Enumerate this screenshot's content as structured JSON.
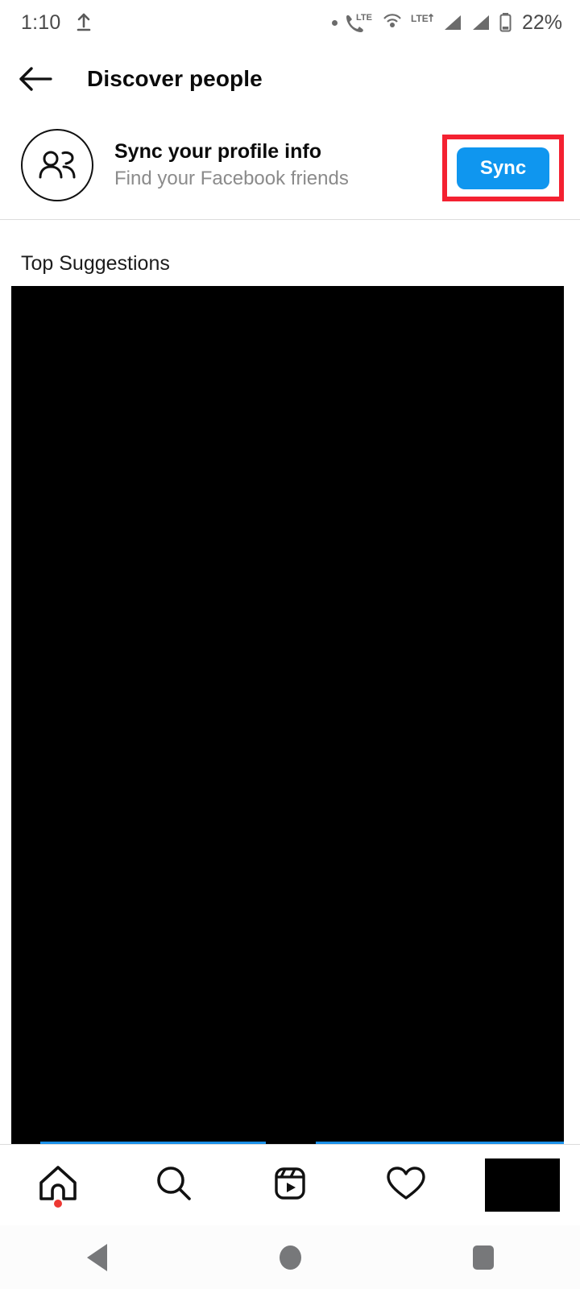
{
  "status_bar": {
    "time": "1:10",
    "upload_icon": "upload-icon",
    "dot_icon": "dot-icon",
    "call_lte_icon": "phone-lte-icon",
    "call_lte_label": "LTE",
    "hotspot_icon": "hotspot-icon",
    "lte_data_icon": "lte-data-icon",
    "lte_data_label": "LTE",
    "signal_one_icon": "signal-bars-icon",
    "signal_two_icon": "signal-bars-icon",
    "battery_icon": "battery-icon",
    "battery_level": "22%"
  },
  "header": {
    "back_icon": "back-arrow-icon",
    "title": "Discover people"
  },
  "sync_card": {
    "avatar_icon": "people-icon",
    "title": "Sync your profile info",
    "subtitle": "Find your Facebook friends",
    "button_label": "Sync",
    "button_color": "#0f96ef",
    "highlight_color": "#f42131"
  },
  "suggestions": {
    "section_title": "Top Suggestions",
    "content_placeholder": "",
    "content_color": "#000000"
  },
  "bottom_nav": {
    "items": [
      {
        "name": "home",
        "icon": "home-icon",
        "has_badge": true
      },
      {
        "name": "search",
        "icon": "search-icon",
        "has_badge": false
      },
      {
        "name": "reels",
        "icon": "reels-icon",
        "has_badge": false
      },
      {
        "name": "activity",
        "icon": "heart-icon",
        "has_badge": false
      },
      {
        "name": "profile",
        "icon": "profile-avatar-icon",
        "has_badge": false
      }
    ],
    "badge_color": "#ed3833"
  },
  "system_nav": {
    "back_icon": "system-back-icon",
    "home_icon": "system-home-icon",
    "recents_icon": "system-recents-icon"
  }
}
